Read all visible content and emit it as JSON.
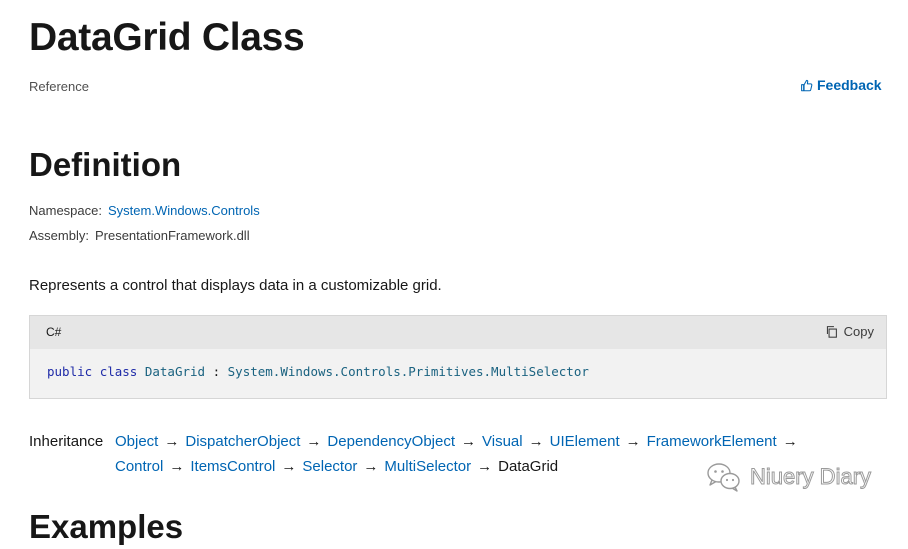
{
  "page": {
    "title": "DataGrid Class",
    "reference_label": "Reference",
    "feedback_label": "Feedback"
  },
  "definition": {
    "heading": "Definition",
    "namespace_label": "Namespace:",
    "namespace_value": "System.Windows.Controls",
    "assembly_label": "Assembly:",
    "assembly_value": "PresentationFramework.dll",
    "summary": "Represents a control that displays data in a customizable grid."
  },
  "code": {
    "language": "C#",
    "copy_label": "Copy",
    "kw_public": "public",
    "kw_class": "class",
    "type_name": "DataGrid",
    "separator": " : ",
    "base_type": "System.Windows.Controls.Primitives.MultiSelector"
  },
  "inheritance": {
    "label": "Inheritance",
    "chain": [
      "Object",
      "DispatcherObject",
      "DependencyObject",
      "Visual",
      "UIElement",
      "FrameworkElement",
      "Control",
      "ItemsControl",
      "Selector",
      "MultiSelector"
    ],
    "current": "DataGrid",
    "arrow": "→"
  },
  "watermark": {
    "text": "Niuery Diary"
  },
  "next_section": {
    "heading": "Examples"
  },
  "colors": {
    "link": "#0065b3",
    "keyword": "#1f2ba8",
    "type": "#1a6280",
    "code_bg": "#f2f2f2",
    "code_header_bg": "#e6e6e6"
  }
}
